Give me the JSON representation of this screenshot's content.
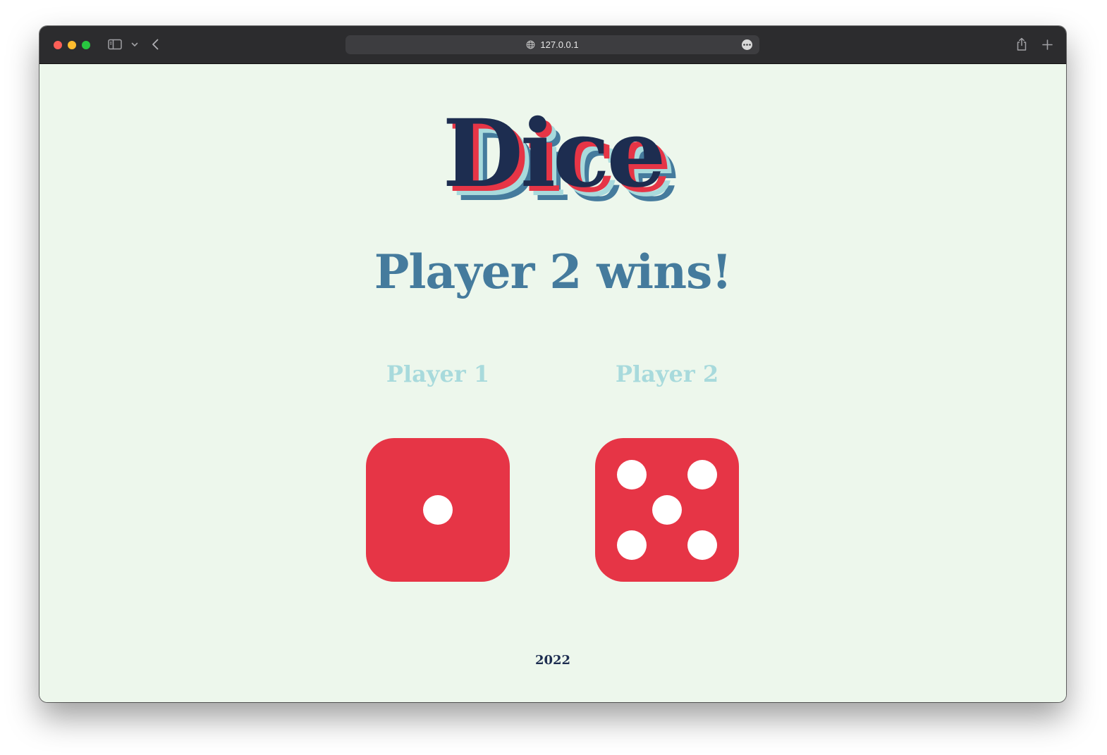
{
  "browser": {
    "url": "127.0.0.1",
    "icons": {
      "sidebar": "sidebar-icon",
      "chevron": "chevron-down-icon",
      "back": "back-arrow-icon",
      "site": "globe-icon",
      "more": "more-options-icon",
      "share": "share-icon",
      "new_tab": "plus-icon"
    }
  },
  "page": {
    "title": "Dice",
    "result": "Player 2 wins!",
    "players": [
      {
        "label": "Player 1",
        "die_value": 1
      },
      {
        "label": "Player 2",
        "die_value": 5
      }
    ],
    "footer": "2022"
  },
  "colors": {
    "background": "#edf7ec",
    "title": "#1d2d50",
    "title_shadow_1": "#e63546",
    "title_shadow_2": "#a8dadc",
    "title_shadow_3": "#457b9d",
    "result": "#457b9d",
    "player_label": "#a8dadc",
    "die": "#e63546",
    "pip": "#ffffff",
    "footer": "#1d2d50"
  }
}
